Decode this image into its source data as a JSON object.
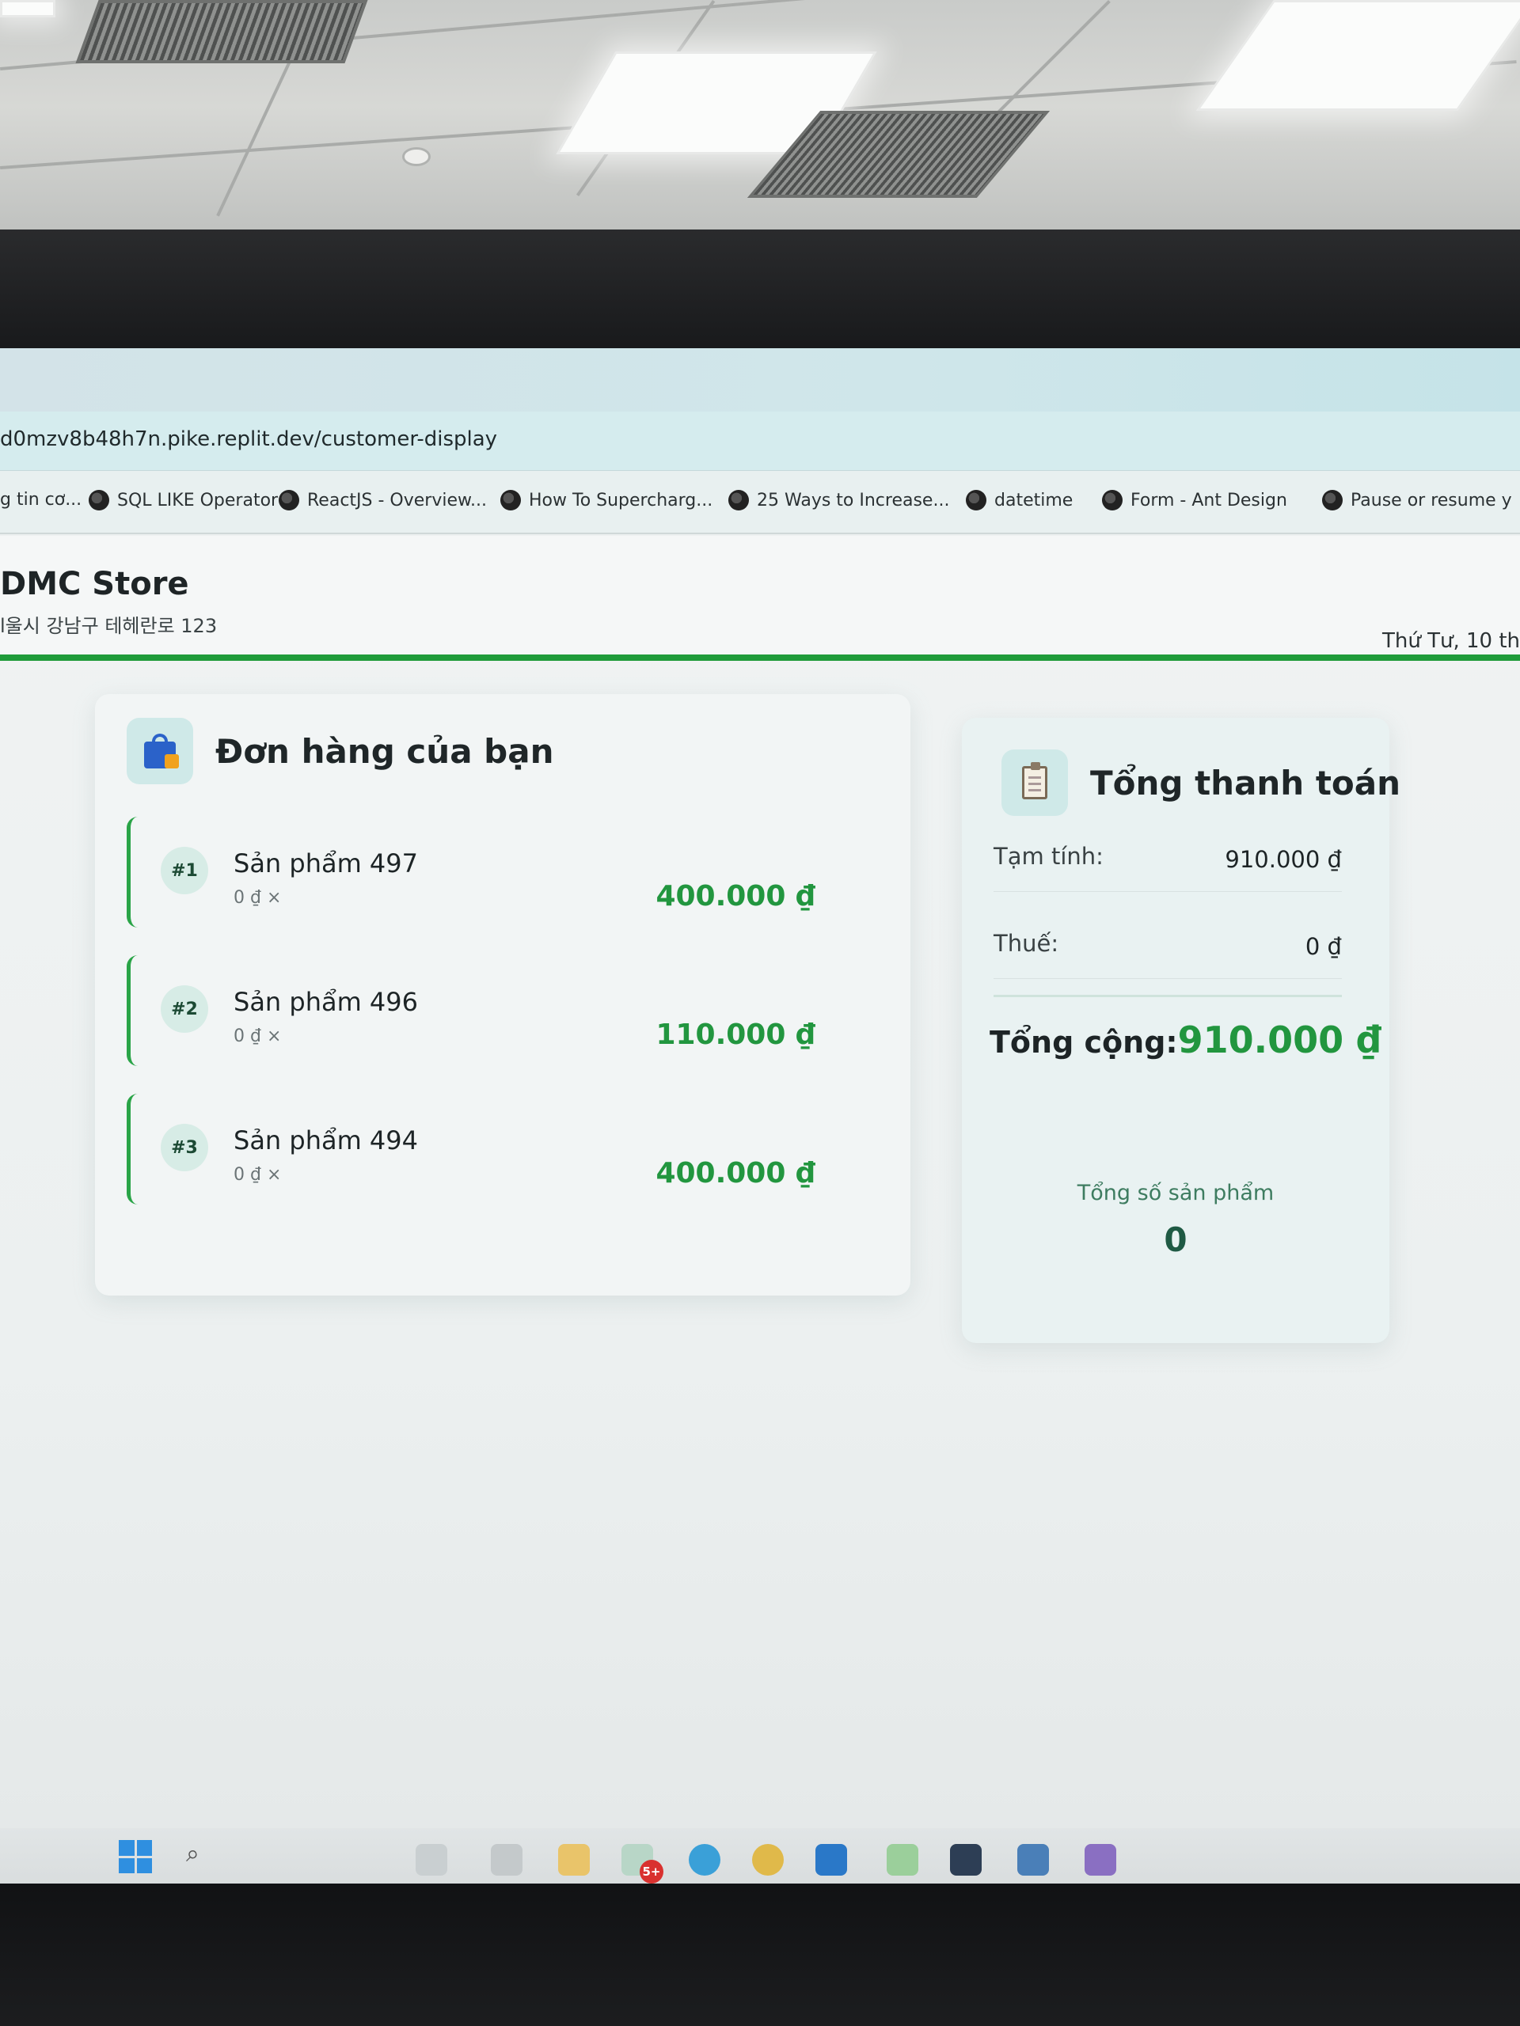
{
  "browser": {
    "url": "d0mzv8b48h7n.pike.replit.dev/customer-display",
    "bookmarks": [
      "g tin cơ...",
      "SQL LIKE Operator",
      "ReactJS - Overview...",
      "How To Supercharg...",
      "25 Ways to Increase...",
      "datetime",
      "Form - Ant Design",
      "Pause or resume y"
    ]
  },
  "store": {
    "name": "DMC Store",
    "address": "l울시 강남구 테헤란로 123",
    "date": "Thứ Tư, 10 th"
  },
  "order": {
    "title": "Đơn hàng của bạn",
    "icon": "shopping-bag-icon",
    "items": [
      {
        "badge": "#1",
        "name": "Sản phẩm 497",
        "unit": "0 ₫ ×",
        "total": "400.000 ₫"
      },
      {
        "badge": "#2",
        "name": "Sản phẩm 496",
        "unit": "0 ₫ ×",
        "total": "110.000 ₫"
      },
      {
        "badge": "#3",
        "name": "Sản phẩm 494",
        "unit": "0 ₫ ×",
        "total": "400.000 ₫"
      }
    ]
  },
  "summary": {
    "title": "Tổng thanh toán",
    "icon": "clipboard-icon",
    "subtotal_label": "Tạm tính:",
    "subtotal_value": "910.000 ₫",
    "tax_label": "Thuế:",
    "tax_value": "0 ₫",
    "grand_label": "Tổng cộng:",
    "grand_value": "910.000 ₫",
    "count_label": "Tổng số sản phẩm",
    "count_value": "0"
  },
  "colors": {
    "accent_green": "#22963f",
    "rule_green": "#1f9b3a"
  },
  "taskbar": {
    "notification_count": "5+"
  }
}
